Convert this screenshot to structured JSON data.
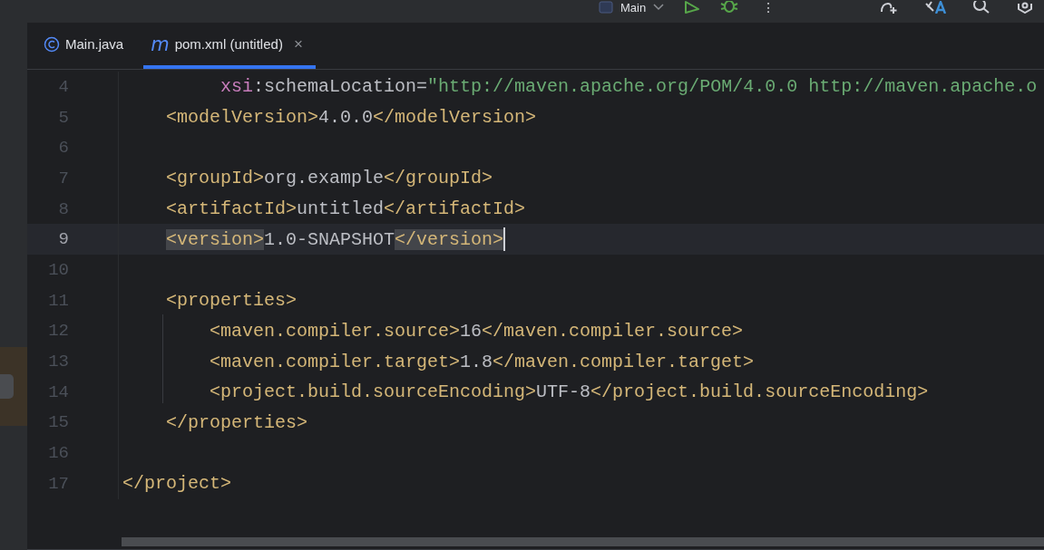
{
  "toolbar": {
    "run_config": "Main",
    "more": "⋮"
  },
  "tabs": [
    {
      "label": "Main.java",
      "kind": "class",
      "selected": false,
      "closable": false
    },
    {
      "label": "pom.xml (untitled)",
      "kind": "maven",
      "glyph": "m",
      "selected": true,
      "closable": true,
      "close": "×"
    }
  ],
  "editor": {
    "lines": [
      {
        "number": "4",
        "selected": false,
        "segments": [
          {
            "kind": "ns",
            "text": "         xsi"
          },
          {
            "kind": "attr",
            "text": ":schemaLocation="
          },
          {
            "kind": "string",
            "text": "\"http://maven.apache.org/POM/4.0.0 http://maven.apache.o"
          }
        ]
      },
      {
        "number": "5",
        "selected": false,
        "segments": [
          {
            "kind": "tag",
            "text": "    <modelVersion>"
          },
          {
            "kind": "text",
            "text": "4.0.0"
          },
          {
            "kind": "tag",
            "text": "</modelVersion>"
          }
        ]
      },
      {
        "number": "6",
        "selected": false
      },
      {
        "number": "7",
        "selected": false,
        "segments": [
          {
            "kind": "tag",
            "text": "    <groupId>"
          },
          {
            "kind": "text",
            "text": "org.example"
          },
          {
            "kind": "tag",
            "text": "</groupId>"
          }
        ]
      },
      {
        "number": "8",
        "selected": false,
        "segments": [
          {
            "kind": "tag",
            "text": "    <artifactId>"
          },
          {
            "kind": "text",
            "text": "untitled"
          },
          {
            "kind": "tag",
            "text": "</artifactId>"
          }
        ]
      },
      {
        "number": "9",
        "selected": true,
        "caret": true,
        "segments": [
          {
            "kind": "tag",
            "text": "    <version>",
            "match": true
          },
          {
            "kind": "text",
            "text": "1.0-SNAPSHOT"
          },
          {
            "kind": "tag",
            "text": "</version>",
            "match": true
          }
        ]
      },
      {
        "number": "10",
        "selected": false
      },
      {
        "number": "11",
        "selected": false,
        "segments": [
          {
            "kind": "tag",
            "text": "    <properties>"
          }
        ]
      },
      {
        "number": "12",
        "selected": false,
        "segments": [
          {
            "kind": "tag",
            "text": "        <maven.compiler.source>"
          },
          {
            "kind": "text",
            "text": "16"
          },
          {
            "kind": "tag",
            "text": "</maven.compiler.source>"
          }
        ]
      },
      {
        "number": "13",
        "selected": false,
        "segments": [
          {
            "kind": "tag",
            "text": "        <maven.compiler.target>"
          },
          {
            "kind": "text",
            "text": "1.8"
          },
          {
            "kind": "tag",
            "text": "</maven.compiler.target>"
          }
        ]
      },
      {
        "number": "14",
        "selected": false,
        "segments": [
          {
            "kind": "tag",
            "text": "        <project.build.sourceEncoding>"
          },
          {
            "kind": "text",
            "text": "UTF-8"
          },
          {
            "kind": "tag",
            "text": "</project.build.sourceEncoding>"
          }
        ]
      },
      {
        "number": "15",
        "selected": false,
        "segments": [
          {
            "kind": "tag",
            "text": "    </properties>"
          }
        ]
      },
      {
        "number": "16",
        "selected": false
      },
      {
        "number": "17",
        "selected": false,
        "segments": [
          {
            "kind": "tag",
            "text": "</project>"
          }
        ]
      }
    ]
  }
}
